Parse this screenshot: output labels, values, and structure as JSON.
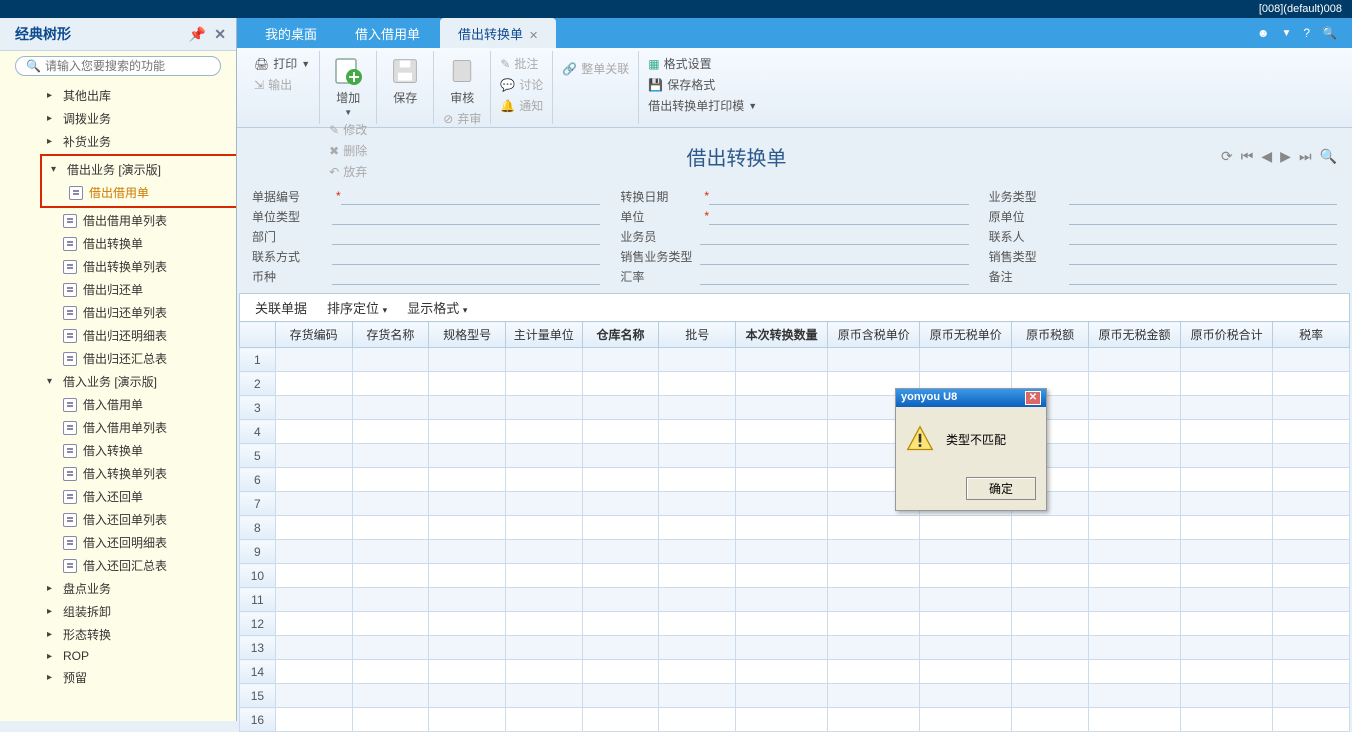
{
  "titlebar": {
    "user": "[008](default)008"
  },
  "sidebar": {
    "title": "经典树形",
    "search_placeholder": "请输入您要搜索的功能",
    "tree": {
      "other_out": "其他出库",
      "dispatch": "调拨业务",
      "supply": "补货业务",
      "lend_out": "借出业务 [演示版]",
      "lend_out_bill": "借出借用单",
      "lend_out_bill_list": "借出借用单列表",
      "lend_out_convert": "借出转换单",
      "lend_out_convert_list": "借出转换单列表",
      "lend_out_return": "借出归还单",
      "lend_out_return_list": "借出归还单列表",
      "lend_out_return_detail": "借出归还明细表",
      "lend_out_return_sum": "借出归还汇总表",
      "lend_in": "借入业务 [演示版]",
      "lend_in_bill": "借入借用单",
      "lend_in_bill_list": "借入借用单列表",
      "lend_in_convert": "借入转换单",
      "lend_in_convert_list": "借入转换单列表",
      "lend_in_return": "借入还回单",
      "lend_in_return_list": "借入还回单列表",
      "lend_in_return_detail": "借入还回明细表",
      "lend_in_return_sum": "借入还回汇总表",
      "stock_check": "盘点业务",
      "assembly": "组装拆卸",
      "form_convert": "形态转换",
      "rop": "ROP",
      "reserve": "预留"
    }
  },
  "tabs": {
    "t1": "我的桌面",
    "t2": "借入借用单",
    "t3": "借出转换单"
  },
  "ribbon": {
    "print": "打印",
    "output": "输出",
    "add": "增加",
    "modify": "修改",
    "delete": "删除",
    "giveup": "放弃",
    "save": "保存",
    "audit": "审核",
    "abandon": "弃审",
    "note": "批注",
    "discuss": "讨论",
    "notify": "通知",
    "whole_link": "整单关联",
    "format_set": "格式设置",
    "save_format": "保存格式",
    "print_template": "借出转换单打印模"
  },
  "form": {
    "title": "借出转换单",
    "f1": "单据编号",
    "f2": "转换日期",
    "f3": "业务类型",
    "f4": "单位类型",
    "f5": "单位",
    "f6": "原单位",
    "f7": "部门",
    "f8": "业务员",
    "f9": "联系人",
    "f10": "联系方式",
    "f11": "销售业务类型",
    "f12": "销售类型",
    "f13": "币种",
    "f14": "汇率",
    "f15": "备注"
  },
  "grid_toolbar": {
    "link": "关联单据",
    "sort": "排序定位",
    "disp": "显示格式"
  },
  "columns": {
    "c1": "存货编码",
    "c2": "存货名称",
    "c3": "规格型号",
    "c4": "主计量单位",
    "c5": "仓库名称",
    "c6": "批号",
    "c7": "本次转换数量",
    "c8": "原币含税单价",
    "c9": "原币无税单价",
    "c10": "原币税额",
    "c11": "原币无税金额",
    "c12": "原币价税合计",
    "c13": "税率"
  },
  "dialog": {
    "title": "yonyou U8",
    "msg": "类型不匹配",
    "ok": "确定"
  }
}
